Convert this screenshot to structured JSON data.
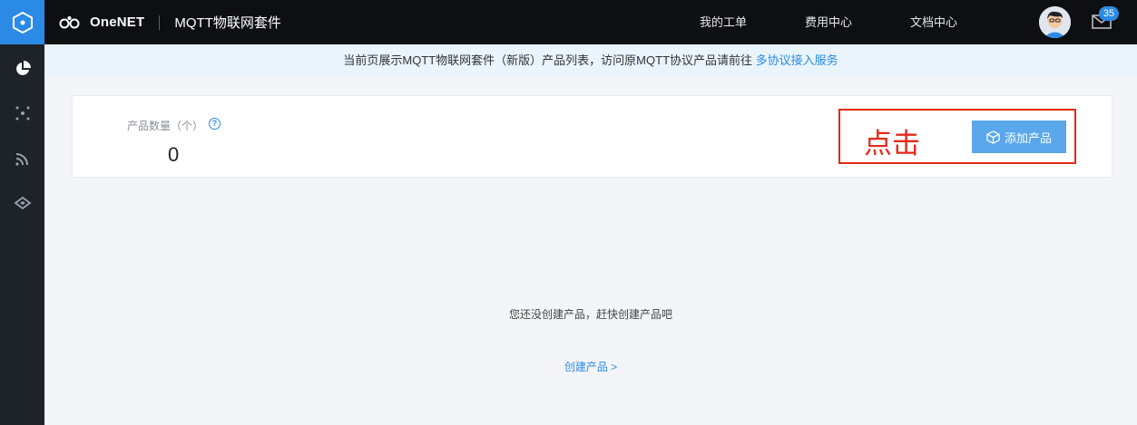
{
  "app": {
    "brand": "OneNET",
    "suite_title": "MQTT物联网套件"
  },
  "topnav": {
    "links": [
      "我的工单",
      "费用中心",
      "文档中心"
    ],
    "unread_count": "35"
  },
  "sidebar": {
    "items": [
      "dashboard-icon",
      "nodes-icon",
      "signal-icon",
      "gateway-icon"
    ]
  },
  "notice": {
    "text": "当前页展示MQTT物联网套件（新版）产品列表，访问原MQTT协议产品请前往 ",
    "link": "多协议接入服务"
  },
  "stats": {
    "label": "产品数量（个）",
    "help": "?",
    "value": "0"
  },
  "annotation": {
    "note": "点击"
  },
  "actions": {
    "add_product": "添加产品"
  },
  "empty_state": {
    "message": "您还没创建产品，赶快创建产品吧",
    "create_link": "创建产品 >"
  },
  "colors": {
    "accent": "#2b8ae6",
    "button": "#5aa7ec",
    "annotation_red": "#e3291b",
    "topbar": "#0d0f13",
    "sidebar": "#1e2229"
  }
}
